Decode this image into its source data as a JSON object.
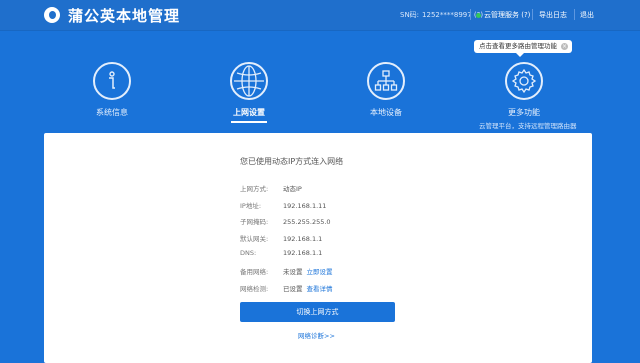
{
  "header": {
    "title": "蒲公英本地管理",
    "sn_label": "SN码:",
    "sn_value": "1252****8997",
    "sn_help": "(?)",
    "cloud_label": "云管理服务",
    "cloud_help": "(?)",
    "export_log": "导出日志",
    "logout": "退出"
  },
  "tooltip": {
    "text": "点击查看更多路由管理功能",
    "close": "×"
  },
  "nav": [
    {
      "label": "系统信息",
      "icon": "info-icon"
    },
    {
      "label": "上网设置",
      "icon": "globe-icon",
      "active": true
    },
    {
      "label": "本地设备",
      "icon": "network-icon"
    },
    {
      "label": "更多功能",
      "icon": "gear-icon",
      "sub": "云管理平台，支持远程管理路由器"
    }
  ],
  "panel": {
    "title": "您已使用动态IP方式连入网络",
    "rows": [
      {
        "label": "上网方式:",
        "value": "动态IP"
      },
      {
        "label": "IP地址:",
        "value": "192.168.1.11"
      },
      {
        "label": "子网掩码:",
        "value": "255.255.255.0"
      },
      {
        "label": "默认网关:",
        "value": "192.168.1.1"
      },
      {
        "label": "DNS:",
        "value": "192.168.1.1"
      },
      {
        "label": "备用网络:",
        "value": "未设置",
        "link": "立即设置"
      },
      {
        "label": "网络检测:",
        "value": "已设置",
        "link": "查看详情"
      }
    ],
    "switch_button": "切换上网方式",
    "diagnose_link": "网络诊断>>"
  },
  "colors": {
    "brand": "#1a73d9",
    "topbar": "#1f6fcc",
    "status_ok": "#34c759"
  }
}
